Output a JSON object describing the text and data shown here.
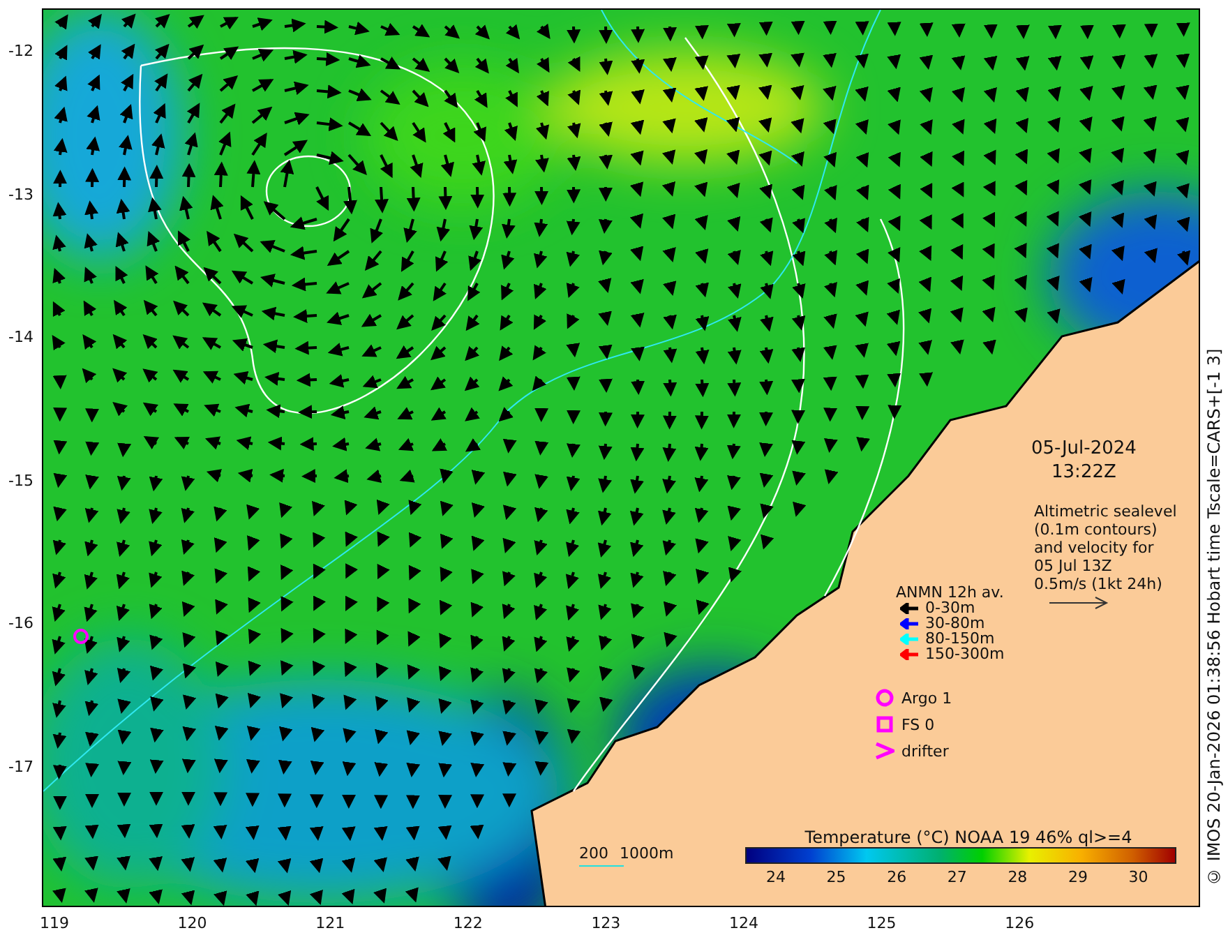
{
  "map": {
    "x_ticks": [
      "119",
      "120",
      "121",
      "122",
      "123",
      "124",
      "125",
      "126"
    ],
    "y_ticks": [
      "-12",
      "-13",
      "-14",
      "-15",
      "-16",
      "-17"
    ],
    "date": "05-Jul-2024",
    "time": "13:22Z",
    "description": "Altimetric sealevel\n(0.1m contours)\nand velocity for\n05 Jul 13Z\n0.5m/s (1kt 24h)",
    "mooring_legend": {
      "title": "ANMN 12h av.",
      "items": [
        {
          "label": "0-30m",
          "color": "#000000"
        },
        {
          "label": "30-80m",
          "color": "#0000ff"
        },
        {
          "label": "80-150m",
          "color": "#00ffff"
        },
        {
          "label": "150-300m",
          "color": "#ff0000"
        }
      ]
    },
    "markers": [
      {
        "kind": "circle",
        "label": "Argo 1"
      },
      {
        "kind": "square",
        "label": "FS 0"
      },
      {
        "kind": "chevron",
        "label": "drifter"
      }
    ],
    "isobaths": {
      "label_1": "200",
      "label_2": "1000m"
    },
    "colorbar": {
      "title": "Temperature (°C) NOAA 19 46% ql>=4",
      "ticks": [
        "24",
        "25",
        "26",
        "27",
        "28",
        "29",
        "30"
      ]
    }
  },
  "credit": "© IMOS 20-Jan-2026 01:38:56 Hobart time Tscale=CARS+[-1 3]"
}
